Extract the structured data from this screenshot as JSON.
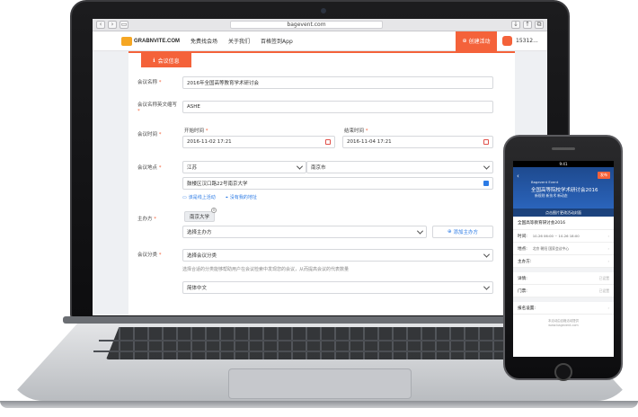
{
  "browser": {
    "url": "bagevent.com"
  },
  "site": {
    "logo_text": "GRABNVITE.COM",
    "nav": [
      "免费找会场",
      "关于我们",
      "百格签到App"
    ],
    "create_button": "创建活动",
    "user": "15312..."
  },
  "form": {
    "tab_label": "会议信息",
    "fields": {
      "name_label": "会议名称",
      "name_value": "2016年全国高等教育学术研讨会",
      "en_name_label": "会议名称英文缩写",
      "en_name_value": "ASHE",
      "time_label": "会议时间",
      "start_label": "开始时间",
      "start_value": "2016-11-02 17:21",
      "end_label": "结束时间",
      "end_value": "2016-11-04 17:21",
      "location_label": "会议地点",
      "province": "江苏",
      "city": "南京市",
      "address": "鼓楼区汉口路22号南京大学",
      "online_link": "该是线上活动",
      "no_address_link": "没有我的地址",
      "organizer_label": "主办方",
      "organizer_tag": "南京大学",
      "organizer_select": "选择主办方",
      "add_organizer": "添加主办方",
      "category_label": "会议分类",
      "category_select": "选择会议分类",
      "category_hint": "选择合适的分类能够帮助用户在会议检索中发现您的会议，从而提高会议的代表数量",
      "language_select": "简体中文"
    }
  },
  "phone": {
    "status": "9:41",
    "badge": "发布",
    "banner_small": "Bagevent Event",
    "banner_title": "全国高等院校学术研讨会2016",
    "banner_sub": "新规则 新技术 新动态",
    "cover_bar": "点击图片更改活动封面",
    "event_title": "全国高等教育研讨会2016",
    "rows": [
      {
        "label": "时间:",
        "value": "10-26 06:00 ~ 10-26 18:00"
      },
      {
        "label": "地点:",
        "value": "北京 朝阳 国家会议中心"
      },
      {
        "label": "主办方:",
        "value": ""
      }
    ],
    "rows2": [
      {
        "label": "详情:",
        "hint": "已设置"
      },
      {
        "label": "门票:",
        "hint": "已设置"
      }
    ],
    "rows3": [
      {
        "label": "报名设置:",
        "hint": ""
      }
    ],
    "footer_line1": "本活动由百格活动提供",
    "footer_line2": "www.bagevent.com"
  }
}
